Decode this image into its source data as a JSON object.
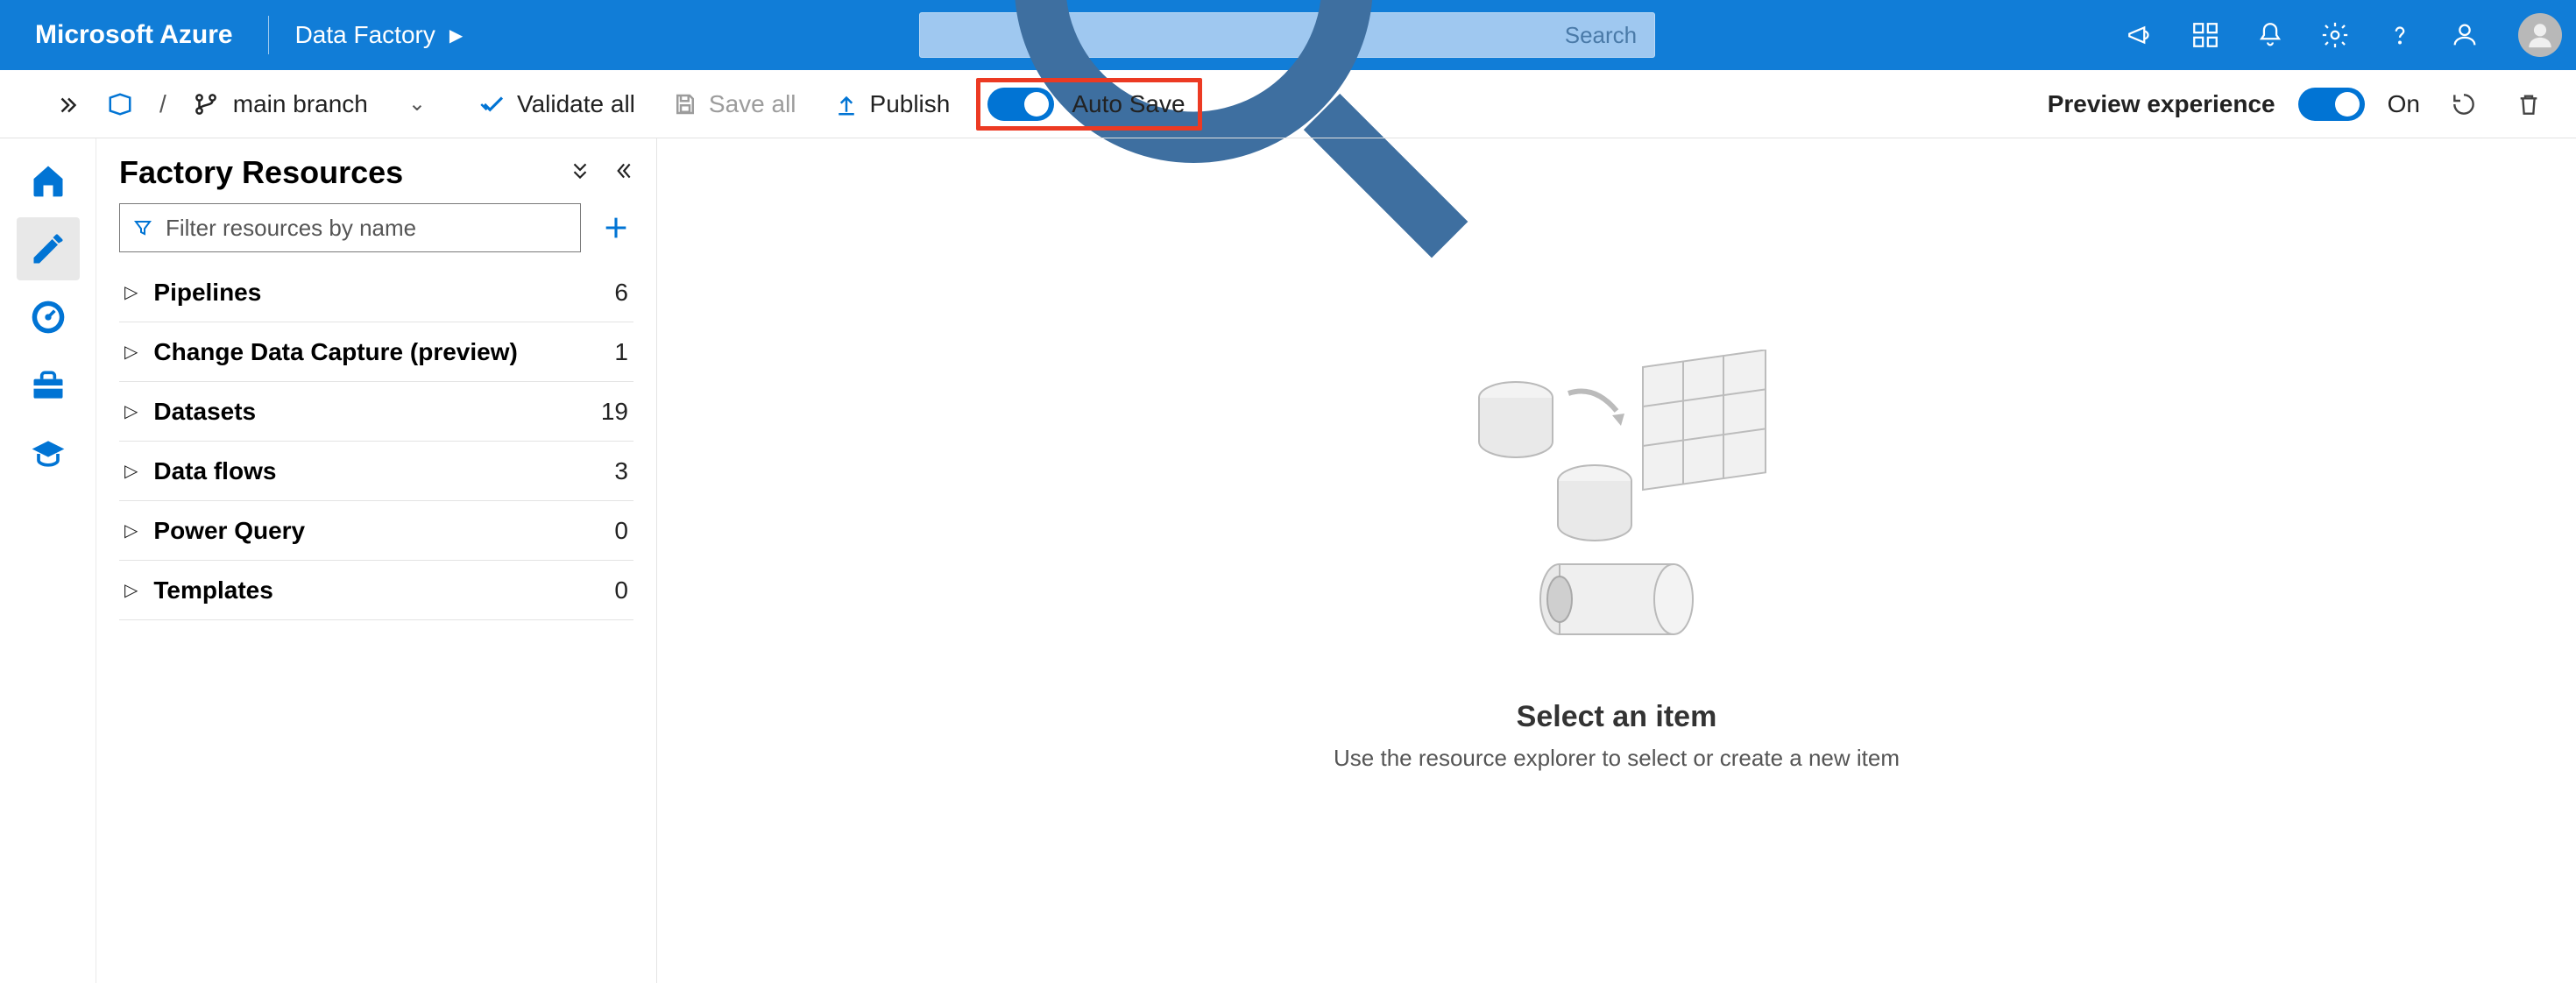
{
  "header": {
    "brand": "Microsoft Azure",
    "crumb": "Data Factory",
    "search_placeholder": "Search"
  },
  "toolbar": {
    "branch_label": "main branch",
    "validate_label": "Validate all",
    "save_all_label": "Save all",
    "publish_label": "Publish",
    "auto_save_label": "Auto Save",
    "preview_label": "Preview experience",
    "preview_toggle_text": "On"
  },
  "panel": {
    "title": "Factory Resources",
    "filter_placeholder": "Filter resources by name",
    "items": [
      {
        "label": "Pipelines",
        "count": "6"
      },
      {
        "label": "Change Data Capture (preview)",
        "count": "1"
      },
      {
        "label": "Datasets",
        "count": "19"
      },
      {
        "label": "Data flows",
        "count": "3"
      },
      {
        "label": "Power Query",
        "count": "0"
      },
      {
        "label": "Templates",
        "count": "0"
      }
    ]
  },
  "empty": {
    "title": "Select an item",
    "subtitle": "Use the resource explorer to select or create a new item"
  }
}
